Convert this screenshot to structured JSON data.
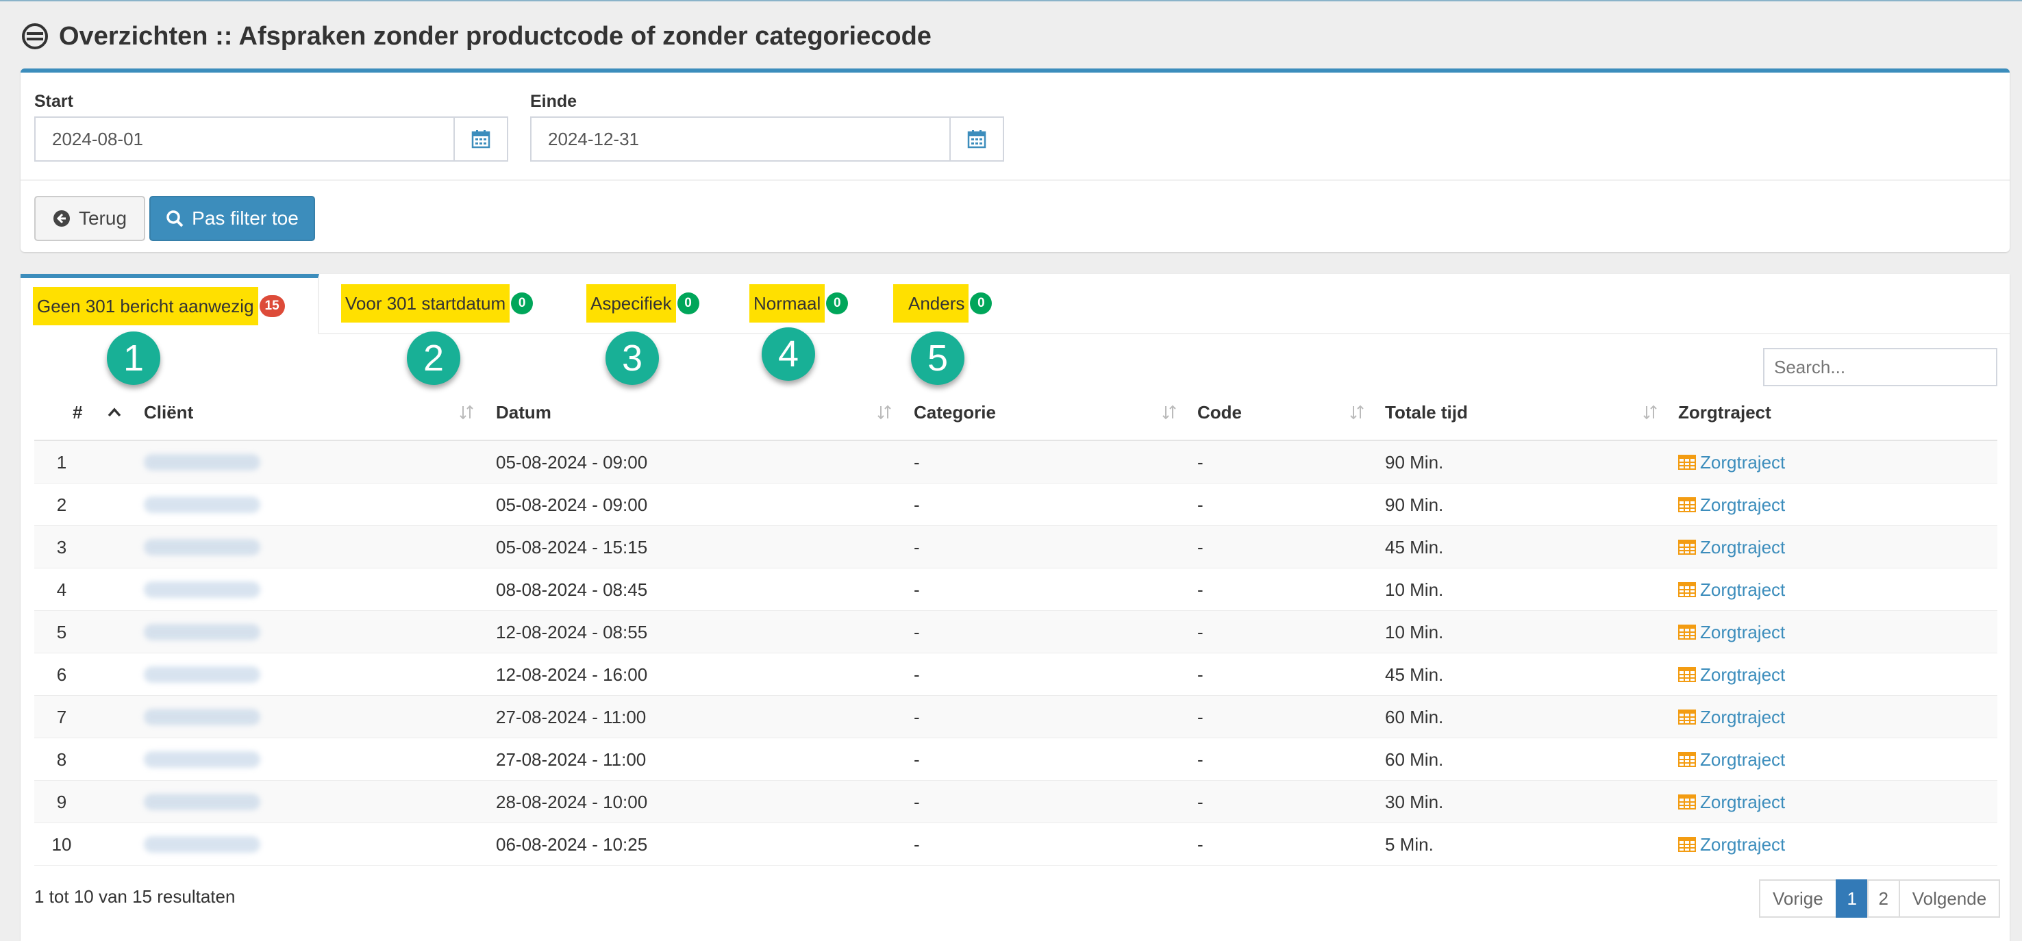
{
  "page": {
    "title": "Overzichten :: Afspraken zonder productcode of zonder categoriecode",
    "title_icon": "stamp-icon"
  },
  "filter": {
    "start_label": "Start",
    "start_value": "2024-08-01",
    "end_label": "Einde",
    "end_value": "2024-12-31",
    "back_label": "Terug",
    "apply_label": "Pas filter toe",
    "accent_color": "#3c8dbc"
  },
  "tabs": [
    {
      "label": "Geen 301 bericht aanwezig",
      "count": "15",
      "badge": "red",
      "marker": "1"
    },
    {
      "label": "Voor 301 startdatum",
      "count": "0",
      "badge": "green",
      "marker": "2"
    },
    {
      "label": "Aspecifiek",
      "count": "0",
      "badge": "green",
      "marker": "3"
    },
    {
      "label": "Normaal",
      "count": "0",
      "badge": "green",
      "marker": "4"
    },
    {
      "label": "Anders",
      "count": "0",
      "badge": "green",
      "marker": "5"
    }
  ],
  "search": {
    "placeholder": "Search..."
  },
  "table": {
    "columns": [
      "#",
      "Cliënt",
      "Datum",
      "Categorie",
      "Code",
      "Totale tijd",
      "Zorgtraject"
    ],
    "rows": [
      {
        "num": "1",
        "datum": "05-08-2024 - 09:00",
        "categorie": "-",
        "code": "-",
        "tijd": "90 Min.",
        "link": "Zorgtraject"
      },
      {
        "num": "2",
        "datum": "05-08-2024 - 09:00",
        "categorie": "-",
        "code": "-",
        "tijd": "90 Min.",
        "link": "Zorgtraject"
      },
      {
        "num": "3",
        "datum": "05-08-2024 - 15:15",
        "categorie": "-",
        "code": "-",
        "tijd": "45 Min.",
        "link": "Zorgtraject"
      },
      {
        "num": "4",
        "datum": "08-08-2024 - 08:45",
        "categorie": "-",
        "code": "-",
        "tijd": "10 Min.",
        "link": "Zorgtraject"
      },
      {
        "num": "5",
        "datum": "12-08-2024 - 08:55",
        "categorie": "-",
        "code": "-",
        "tijd": "10 Min.",
        "link": "Zorgtraject"
      },
      {
        "num": "6",
        "datum": "12-08-2024 - 16:00",
        "categorie": "-",
        "code": "-",
        "tijd": "45 Min.",
        "link": "Zorgtraject"
      },
      {
        "num": "7",
        "datum": "27-08-2024 - 11:00",
        "categorie": "-",
        "code": "-",
        "tijd": "60 Min.",
        "link": "Zorgtraject"
      },
      {
        "num": "8",
        "datum": "27-08-2024 - 11:00",
        "categorie": "-",
        "code": "-",
        "tijd": "60 Min.",
        "link": "Zorgtraject"
      },
      {
        "num": "9",
        "datum": "28-08-2024 - 10:00",
        "categorie": "-",
        "code": "-",
        "tijd": "30 Min.",
        "link": "Zorgtraject"
      },
      {
        "num": "10",
        "datum": "06-08-2024 - 10:25",
        "categorie": "-",
        "code": "-",
        "tijd": "5 Min.",
        "link": "Zorgtraject"
      }
    ]
  },
  "footer": {
    "info": "1 tot 10 van 15 resultaten",
    "prev": "Vorige",
    "pages": [
      "1",
      "2"
    ],
    "next": "Volgende"
  }
}
